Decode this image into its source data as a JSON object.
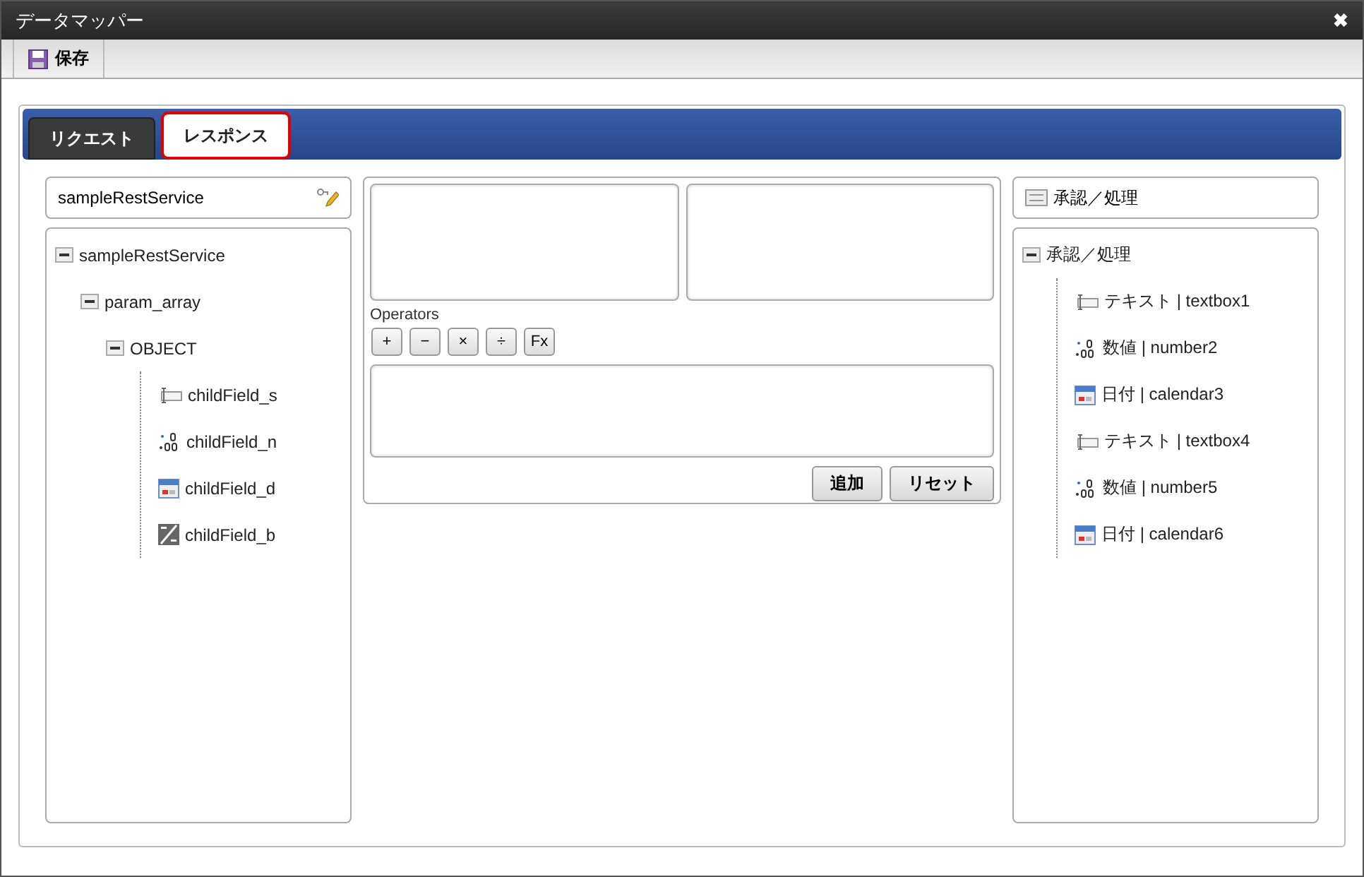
{
  "window": {
    "title": "データマッパー",
    "close": "✖"
  },
  "toolbar": {
    "buttons": [
      "保存"
    ]
  },
  "tabs": [
    {
      "label": "リクエスト",
      "selected": false
    },
    {
      "label": "レスポンス",
      "selected": true
    }
  ],
  "source": {
    "header": "sampleRestService",
    "tree": [
      {
        "label": "sampleRestService",
        "kind": "group",
        "expanded": true,
        "children": [
          {
            "label": "param_array",
            "kind": "group",
            "expanded": true,
            "children": [
              {
                "label": "OBJECT",
                "kind": "group",
                "expanded": true,
                "children": [
                  {
                    "label": "childField_s",
                    "kind": "text"
                  },
                  {
                    "label": "childField_n",
                    "kind": "number"
                  },
                  {
                    "label": "childField_d",
                    "kind": "date"
                  },
                  {
                    "label": "childField_b",
                    "kind": "boolean"
                  }
                ]
              }
            ]
          }
        ]
      }
    ]
  },
  "editor": {
    "operators_label": "Operators",
    "operators": [
      "+",
      "−",
      "×",
      "÷",
      "Fx"
    ],
    "buttons": [
      "追加",
      "リセット"
    ]
  },
  "target": {
    "header": "承認／処理",
    "tree": [
      {
        "label": "承認／処理",
        "kind": "group",
        "expanded": true,
        "children": [
          {
            "label": "テキスト | textbox1",
            "kind": "text"
          },
          {
            "label": "数値 | number2",
            "kind": "number"
          },
          {
            "label": "日付 | calendar3",
            "kind": "date"
          },
          {
            "label": "テキスト | textbox4",
            "kind": "text"
          },
          {
            "label": "数値 | number5",
            "kind": "number"
          },
          {
            "label": "日付 | calendar6",
            "kind": "date"
          }
        ]
      }
    ]
  }
}
